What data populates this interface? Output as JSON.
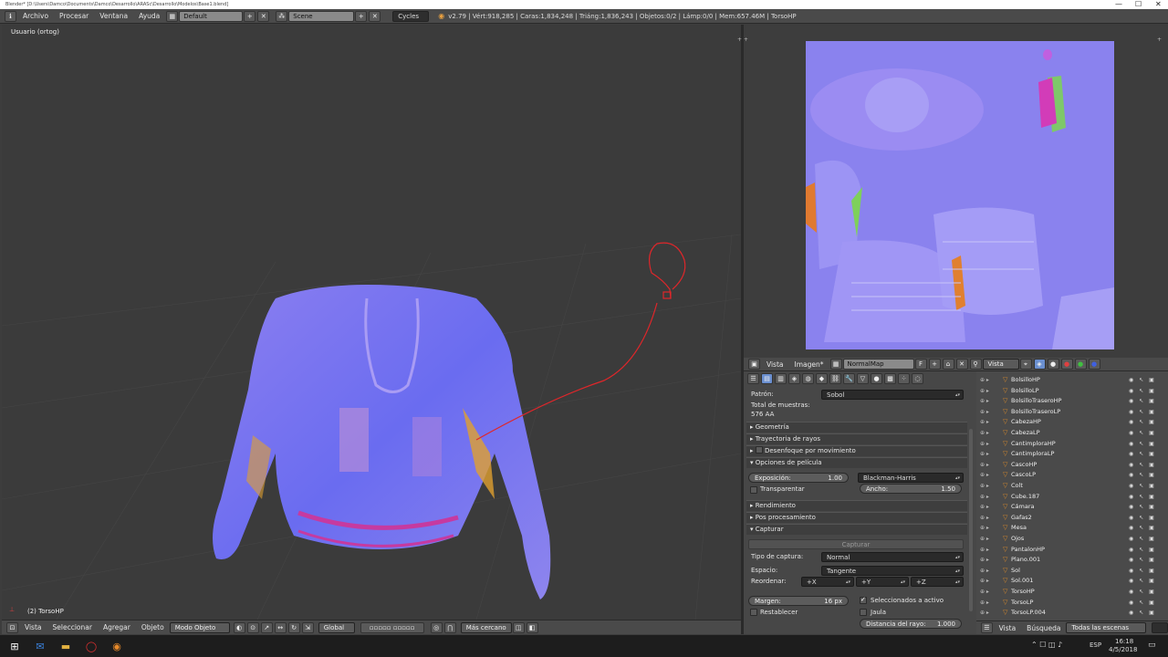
{
  "window": {
    "title": "Blender* [D:\\Users\\Damco\\Documents\\Damco\\Desarrollo\\ARASc\\Desarrollo\\Modelos\\Base1.blend]"
  },
  "menubar": {
    "menu": [
      "Archivo",
      "Procesar",
      "Ventana",
      "Ayuda"
    ],
    "layout": "Default",
    "scene": "Scene",
    "engine": "Cycles",
    "stats": "v2.79 | Vért:918,285 | Caras:1,834,248 | Triáng:1,836,243 | Objetos:0/2 | Lámp:0/0 | Mem:657.46M | TorsoHP"
  },
  "viewport": {
    "label": "Usuario (ortog)",
    "object": "(2) TorsoHP"
  },
  "viewport_header": {
    "menu": [
      "Vista",
      "Seleccionar",
      "Agregar",
      "Objeto"
    ],
    "mode": "Modo Objeto",
    "orientation": "Global",
    "snap": "Más cercano"
  },
  "image_header": {
    "menu": [
      "Vista",
      "Imagen*"
    ],
    "image_name": "NormalMap",
    "f_label": "F",
    "view": "Vista"
  },
  "properties": {
    "patron_label": "Patrón:",
    "patron_value": "Sobol",
    "total_label": "Total de muestras:",
    "total_value": "576 AA",
    "panels": [
      "Geometría",
      "Trayectoria de rayos",
      "Desenfoque por movimiento",
      "Opciones de película",
      "Rendimiento",
      "Pos procesamiento",
      "Capturar"
    ],
    "exposicion_label": "Exposición:",
    "exposicion_value": "1.00",
    "filter": "Blackman-Harris",
    "transparentar": "Transparentar",
    "ancho_label": "Ancho:",
    "ancho_value": "1.50",
    "capturar_button": "Capturar",
    "tipo_label": "Tipo de captura:",
    "tipo_value": "Normal",
    "espacio_label": "Espacio:",
    "espacio_value": "Tangente",
    "reordenar_label": "Reordenar:",
    "axes": [
      "+X",
      "+Y",
      "+Z"
    ],
    "margen_label": "Margen:",
    "margen_value": "16 px",
    "seleccionados": "Seleccionados a activo",
    "jaula": "Jaula",
    "restablecer": "Restablecer",
    "distancia_label": "Distancia del rayo:",
    "distancia_value": "1.000"
  },
  "outliner": {
    "items": [
      "BolsilloHP",
      "BolsilloLP",
      "BolsilloTraseroHP",
      "BolsilloTraseroLP",
      "CabezaHP",
      "CabezaLP",
      "CantimploraHP",
      "CantimploraLP",
      "CascoHP",
      "CascoLP",
      "Colt",
      "Cube.187",
      "Cámara",
      "Gafas2",
      "Mesa",
      "Ojos",
      "PantalonHP",
      "Plano.001",
      "Sol",
      "Sol.001",
      "TorsoHP",
      "TorsoLP",
      "TorsoLP.004"
    ],
    "footer_menu": [
      "Vista",
      "Búsqueda"
    ],
    "filter": "Todas las escenas"
  },
  "taskbar": {
    "time": "16:18",
    "date": "4/5/2018",
    "lang": "ESP"
  },
  "colors": {
    "bg": "#3d3d3d",
    "header": "#4a4a4a",
    "normalmap": "#8a82ee",
    "annotation": "#e0262a"
  }
}
